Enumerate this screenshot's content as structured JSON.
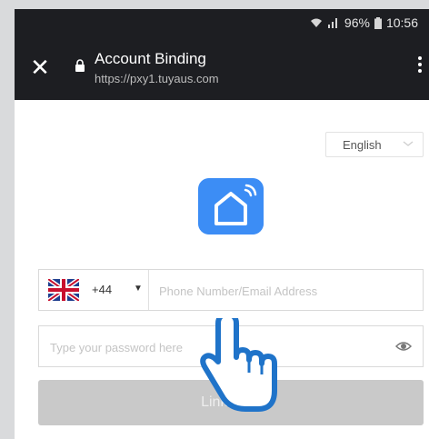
{
  "status_bar": {
    "battery": "96%",
    "time": "10:56",
    "icons": [
      "wifi-icon",
      "signal-icon",
      "battery-icon"
    ]
  },
  "app_bar": {
    "title": "Account Binding",
    "url": "https://pxy1.tuyaus.com",
    "close_glyph": "✕",
    "icons": [
      "close-icon",
      "lock-icon",
      "more-vert-icon"
    ]
  },
  "language": {
    "selected": "English"
  },
  "phone": {
    "country_code": "+44",
    "flag": "uk-flag-icon",
    "placeholder": "Phone Number/Email Address"
  },
  "password": {
    "placeholder": "Type your password here",
    "icon": "eye-icon"
  },
  "link_button": {
    "label": "Link Now"
  },
  "colors": {
    "top_bar": "#1d1e22",
    "app_icon": "#3c8df5",
    "button_disabled": "#c9c9c9",
    "hand_outline": "#1f73c9"
  }
}
